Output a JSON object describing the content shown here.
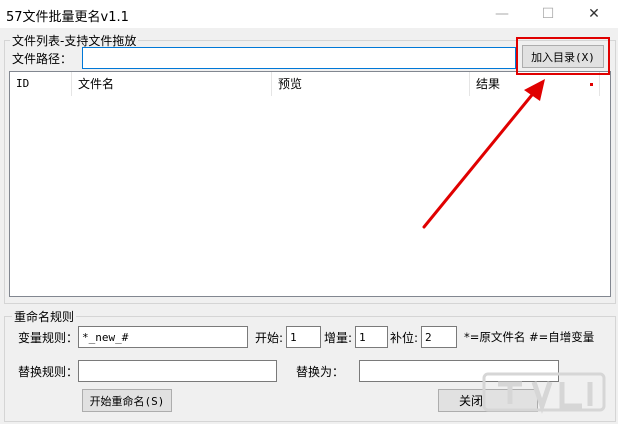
{
  "window": {
    "title": "57文件批量更名v1.1",
    "minimize_glyph": "—",
    "maximize_glyph": "☐",
    "close_glyph": "✕"
  },
  "file_group": {
    "label": "文件列表-支持文件拖放",
    "path_label": "文件路径：",
    "path_value": "",
    "add_dir_button": "加入目录(X)"
  },
  "file_list": {
    "columns": [
      "ID",
      "文件名",
      "预览",
      "结果"
    ],
    "rows": []
  },
  "rename_group": {
    "label": "重命名规则",
    "var_rule_label": "变量规则：",
    "var_rule_value": "*_new_#",
    "start_label": "开始:",
    "start_value": "1",
    "increment_label": "增量:",
    "increment_value": "1",
    "pad_label": "补位:",
    "pad_value": "2",
    "hint": "*=原文件名 #=自增变量",
    "replace_rule_label": "替换规则：",
    "replace_rule_value": "",
    "replace_with_label": "替换为：",
    "replace_with_value": "",
    "start_button": "开始重命名(S)",
    "close_button": "关闭"
  },
  "annotation_color": "#e00000",
  "watermark_icon": "watermark-logo"
}
